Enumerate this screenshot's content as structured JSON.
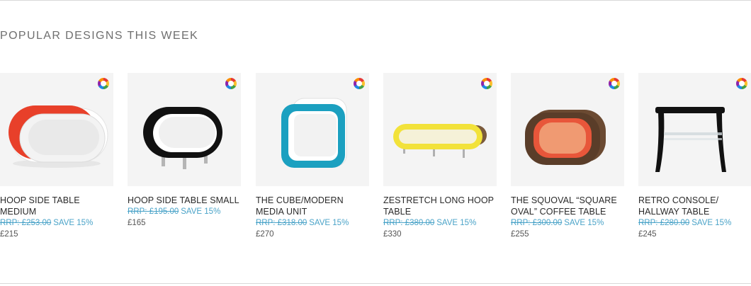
{
  "section": {
    "title": "POPULAR DESIGNS THIS WEEK"
  },
  "products": [
    {
      "name": "HOOP SIDE TABLE MEDIUM",
      "rrp": "RRP: £253.00",
      "save": "SAVE 15%",
      "price": "£215",
      "colors_icon": "color-wheel-icon",
      "image_color": "#e8402a"
    },
    {
      "name": "HOOP SIDE TABLE SMALL",
      "rrp": "RRP: £195.00",
      "save": "SAVE 15%",
      "price": "£165",
      "colors_icon": "color-wheel-icon",
      "image_color": "#111111"
    },
    {
      "name": "THE CUBE/MODERN MEDIA UNIT",
      "rrp": "RRP: £318.00",
      "save": "SAVE 15%",
      "price": "£270",
      "colors_icon": "color-wheel-icon",
      "image_color": "#1ba0c0"
    },
    {
      "name": "ZESTRETCH LONG HOOP TABLE",
      "rrp": "RRP: £380.00",
      "save": "SAVE 15%",
      "price": "£330",
      "colors_icon": "color-wheel-icon",
      "image_color": "#f2e23a"
    },
    {
      "name": "THE SQUOVAL “SQUARE OVAL” COFFEE TABLE",
      "rrp": "RRP: £300.00",
      "save": "SAVE 15%",
      "price": "£255",
      "colors_icon": "color-wheel-icon",
      "image_color": "#e8563a"
    },
    {
      "name": "RETRO CONSOLE/ HALLWAY TABLE",
      "rrp": "RRP: £280.00",
      "save": "SAVE 15%",
      "price": "£245",
      "colors_icon": "color-wheel-icon",
      "image_color": "#111111"
    }
  ],
  "colors": {
    "accent_price": "#4aa3c8",
    "title_gray": "#6f6f6f",
    "thumb_bg": "#f4f4f4"
  }
}
